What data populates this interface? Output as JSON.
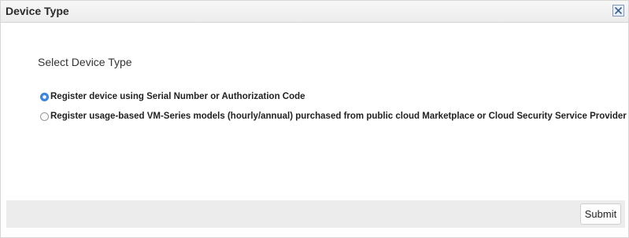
{
  "dialog": {
    "title": "Device Type",
    "close_icon": "close-icon"
  },
  "form": {
    "section_label": "Select Device Type",
    "options": [
      {
        "label": "Register device using Serial Number or Authorization Code",
        "selected": true
      },
      {
        "label": "Register usage-based VM-Series models (hourly/annual) purchased from public cloud Marketplace or Cloud Security Service Provider (CSSP)",
        "selected": false
      }
    ]
  },
  "footer": {
    "submit_label": "Submit"
  },
  "colors": {
    "radio_selected": "#3d87e8",
    "titlebar": "#ececec",
    "footer": "#ececec"
  }
}
